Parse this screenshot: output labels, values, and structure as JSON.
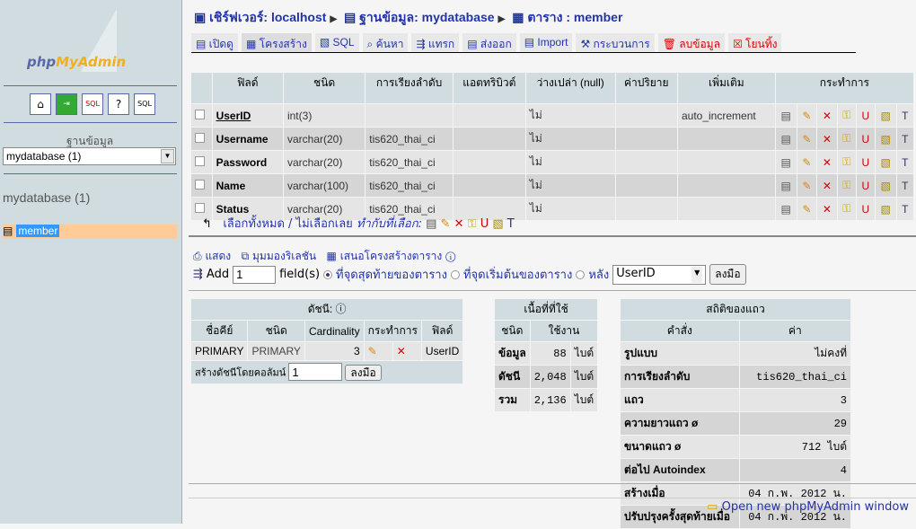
{
  "sidebar": {
    "logo": "phpMyAdmin",
    "logo_a": "php",
    "logo_b": "My",
    "logo_c": "Admin",
    "db_label": "ฐานข้อมูล",
    "db_select": "mydatabase (1)",
    "db_name": "mydatabase (1)",
    "table": "member"
  },
  "breadcrumb": {
    "server": "เชิร์ฟเวอร์: localhost",
    "database": "ฐานข้อมูล: mydatabase",
    "table": "ตาราง : member"
  },
  "tabs": [
    "เปิดดู",
    "โครงสร้าง",
    "SQL",
    "ค้นหา",
    "แทรก",
    "ส่งออก",
    "Import",
    "กระบวนการ",
    "ลบข้อมูล",
    "โยนทิ้ง"
  ],
  "structure": {
    "headers": [
      "ฟิลด์",
      "ชนิด",
      "การเรียงลำดับ",
      "แอตทริบิวต์",
      "ว่างเปล่า (null)",
      "ค่าปริยาย",
      "เพิ่มเติม",
      "กระทำการ"
    ],
    "rows": [
      [
        "UserID",
        "int(3)",
        "",
        "",
        "ไม่",
        "",
        "auto_increment"
      ],
      [
        "Username",
        "varchar(20)",
        "tis620_thai_ci",
        "",
        "ไม่",
        "",
        ""
      ],
      [
        "Password",
        "varchar(20)",
        "tis620_thai_ci",
        "",
        "ไม่",
        "",
        ""
      ],
      [
        "Name",
        "varchar(100)",
        "tis620_thai_ci",
        "",
        "ไม่",
        "",
        ""
      ],
      [
        "Status",
        "varchar(20)",
        "tis620_thai_ci",
        "",
        "ไม่",
        "",
        ""
      ]
    ]
  },
  "selection": {
    "all": "เลือกทั้งหมด",
    "sep": " / ",
    "none": "ไม่เลือกเลย",
    "with": "ทำกับที่เลือก:"
  },
  "ops": {
    "print": "แสดง",
    "relation": "มุมมองริเลชัน",
    "propose": "เสนอโครงสร้างตาราง"
  },
  "add": {
    "label": "Add",
    "count": "1",
    "fields": "field(s)",
    "end": "ที่จุดสุดท้ายของตาราง",
    "begin": "ที่จุดเริ่มต้นของตาราง",
    "after": "หลัง",
    "after_field": "UserID",
    "go": "ลงมือ"
  },
  "indexes": {
    "title": "ดัชนี:",
    "headers": [
      "ชื่อคีย์",
      "ชนิด",
      "Cardinality",
      "กระทำการ",
      "ฟิลด์"
    ],
    "row": [
      "PRIMARY",
      "PRIMARY",
      "3",
      "UserID"
    ],
    "create_label": "สร้างดัชนีโดยคอลัมน์",
    "create_count": "1",
    "go": "ลงมือ"
  },
  "space": {
    "title": "เนื้อที่ที่ใช้",
    "headers": [
      "ชนิด",
      "ใช้งาน"
    ],
    "rows": [
      [
        "ข้อมูล",
        "88",
        "ไบต์"
      ],
      [
        "ดัชนี",
        "2,048",
        "ไบต์"
      ],
      [
        "รวม",
        "2,136",
        "ไบต์"
      ]
    ]
  },
  "stats": {
    "title": "สถิติของแถว",
    "headers": [
      "คำสั่ง",
      "ค่า"
    ],
    "rows": [
      [
        "รูปแบบ",
        "ไม่คงที่"
      ],
      [
        "การเรียงลำดับ",
        "tis620_thai_ci"
      ],
      [
        "แถว",
        "3"
      ],
      [
        "ความยาวแถว ø",
        "29"
      ],
      [
        "ขนาดแถว ø",
        "712 ไบต์"
      ],
      [
        "ต่อไป Autoindex",
        "4"
      ],
      [
        "สร้างเมื่อ",
        "04 ก.พ. 2012 น."
      ],
      [
        "ปรับปรุงครั้งสุดท้ายเมื่อ",
        "04 ก.พ. 2012 น."
      ]
    ]
  },
  "footer": "Open new phpMyAdmin window"
}
